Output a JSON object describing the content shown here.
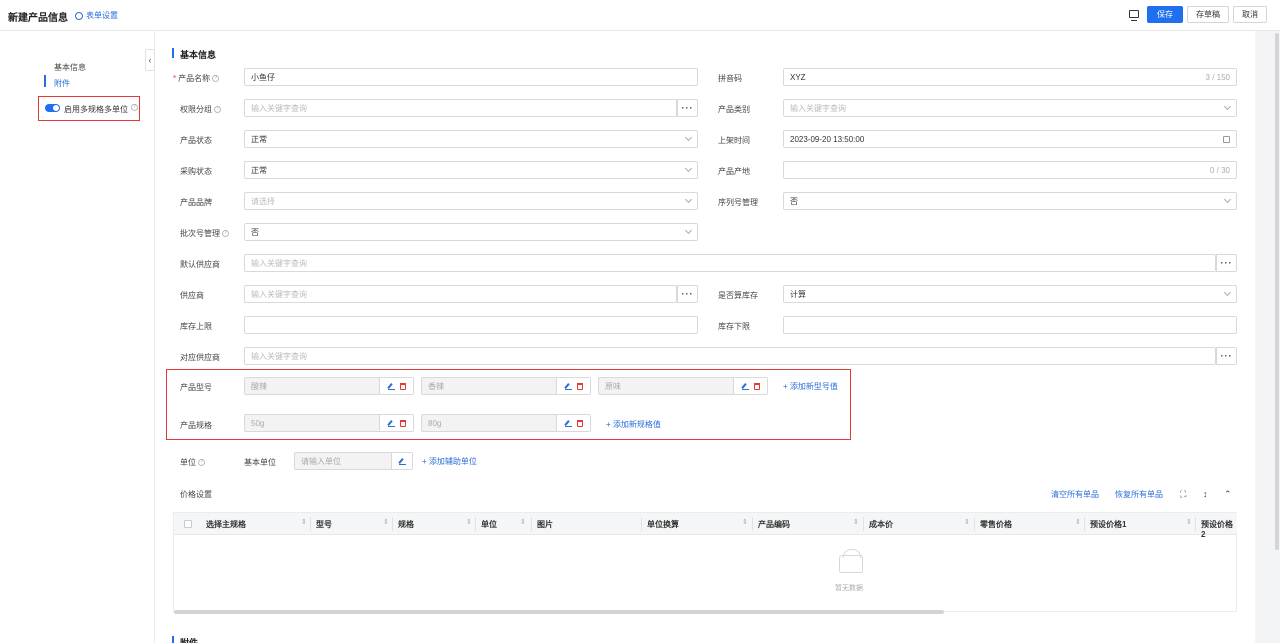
{
  "header": {
    "title": "新建产品信息",
    "form_settings": "表单设置",
    "save": "保存",
    "draft": "存草稿",
    "cancel": "取消"
  },
  "sidebar": {
    "items": [
      {
        "label": "基本信息",
        "active": false
      },
      {
        "label": "附件",
        "active": true
      }
    ],
    "toggle_label": "启用多规格多单位",
    "toggle_on": true
  },
  "basic_info": {
    "section_title": "基本信息",
    "product_name": {
      "label": "产品名称",
      "value": "小鱼仔"
    },
    "pinyin": {
      "label": "拼音码",
      "value": "XYZ",
      "counter": "3 / 150"
    },
    "permission_group": {
      "label": "权限分组",
      "placeholder": "输入关键字查询"
    },
    "category": {
      "label": "产品类别",
      "placeholder": "输入关键字查询"
    },
    "status": {
      "label": "产品状态",
      "value": "正常"
    },
    "listing_time": {
      "label": "上架时间",
      "value": "2023-09-20 13:50:00"
    },
    "purchase_status": {
      "label": "采购状态",
      "value": "正常"
    },
    "origin": {
      "label": "产品产地",
      "counter": "0 / 30"
    },
    "brand": {
      "label": "产品品牌",
      "placeholder": "请选择"
    },
    "serial_mgmt": {
      "label": "序列号管理",
      "value": "否"
    },
    "batch_mgmt": {
      "label": "批次号管理",
      "value": "否"
    },
    "default_supplier": {
      "label": "默认供应商",
      "placeholder": "输入关键字查询"
    },
    "supplier": {
      "label": "供应商",
      "placeholder": "输入关键字查询"
    },
    "count_stock": {
      "label": "是否算库存",
      "value": "计算"
    },
    "stock_upper": {
      "label": "库存上限"
    },
    "stock_lower": {
      "label": "库存下限"
    },
    "matching_supplier": {
      "label": "对应供应商",
      "placeholder": "输入关键字查询"
    }
  },
  "models": {
    "label": "产品型号",
    "values": [
      "酸辣",
      "香辣",
      "原味"
    ],
    "add_label": "添加新型号值"
  },
  "specs": {
    "label": "产品规格",
    "values": [
      "50g",
      "80g"
    ],
    "add_label": "添加新规格值"
  },
  "units": {
    "label": "单位",
    "base_label": "基本单位",
    "placeholder": "请输入单位",
    "add_label": "添加辅助单位"
  },
  "price": {
    "title": "价格设置",
    "clear_all": "清空所有单品",
    "restore_all": "恢复所有单品",
    "columns": [
      "选择主规格",
      "型号",
      "规格",
      "单位",
      "图片",
      "单位换算",
      "产品编码",
      "成本价",
      "零售价格",
      "预设价格1",
      "预设价格2"
    ],
    "empty_text": "暂无数据"
  },
  "attachments": {
    "section_title": "附件"
  }
}
